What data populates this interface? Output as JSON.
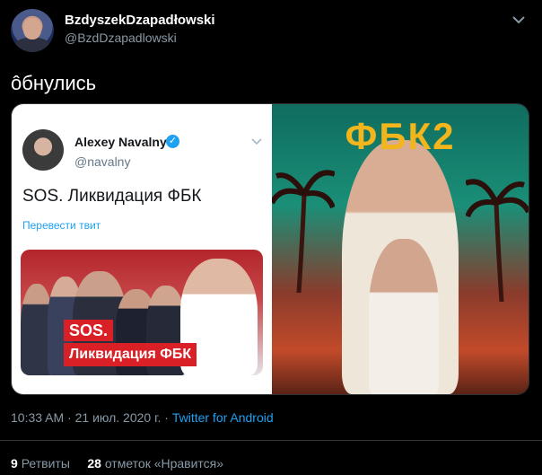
{
  "author": {
    "display_name": "BzdyszekDzapadłowski",
    "handle": "@BzdDzapadlowski"
  },
  "tweet_text": "ôбнулись",
  "quoted": {
    "name": "Alexey Navalny",
    "handle": "@navalny",
    "text": "SOS. Ликвидация ФБК",
    "translate_label": "Перевести твит",
    "image_text": {
      "sos": "SOS.",
      "liquidation": "Ликвидация ФБК"
    }
  },
  "game_image": {
    "title": "ФБК2"
  },
  "meta": {
    "time": "10:33 AM",
    "date": "21 июл. 2020 г.",
    "client": "Twitter for Android"
  },
  "stats": {
    "retweets_count": "9",
    "retweets_label": "Ретвиты",
    "likes_count": "28",
    "likes_label": "отметок «Нравится»"
  },
  "colors": {
    "background": "#000000",
    "link": "#1da1f2",
    "muted": "#8899a6",
    "accent": "#f2b51c"
  }
}
